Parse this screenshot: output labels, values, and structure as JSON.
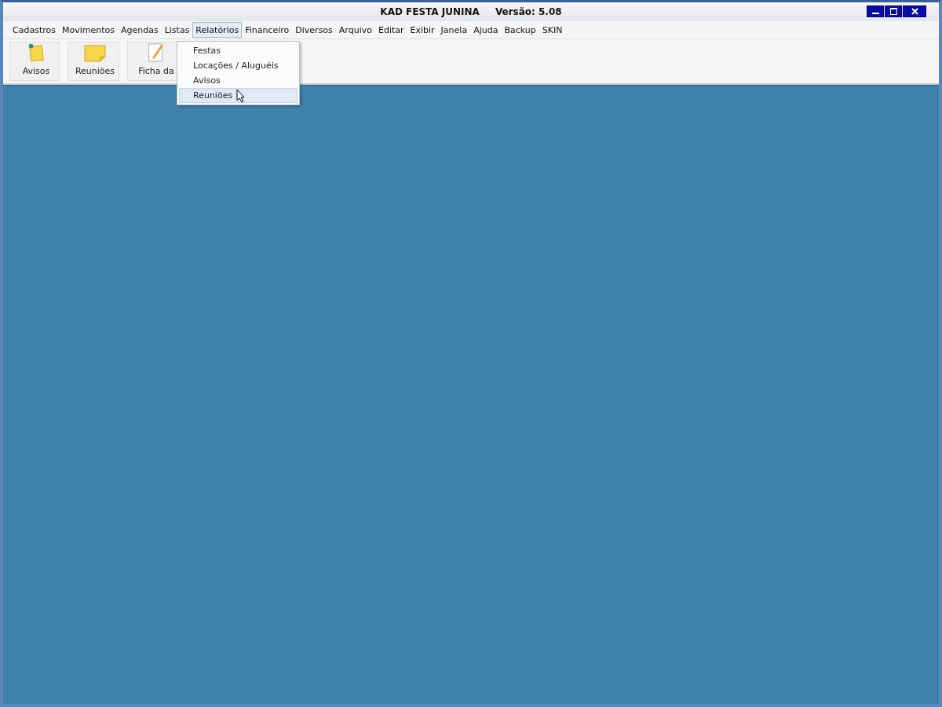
{
  "window": {
    "title": "KAD FESTA JUNINA",
    "version": "Versão: 5.08"
  },
  "menu": [
    {
      "label": "Cadastros",
      "selected": false
    },
    {
      "label": "Movimentos",
      "selected": false
    },
    {
      "label": "Agendas",
      "selected": false
    },
    {
      "label": "Listas",
      "selected": false
    },
    {
      "label": "Relatórios",
      "selected": true
    },
    {
      "label": "Financeiro",
      "selected": false
    },
    {
      "label": "Diversos",
      "selected": false
    },
    {
      "label": "Arquivo",
      "selected": false
    },
    {
      "label": "Editar",
      "selected": false
    },
    {
      "label": "Exibir",
      "selected": false
    },
    {
      "label": "Janela",
      "selected": false
    },
    {
      "label": "Ajuda",
      "selected": false
    },
    {
      "label": "Backup",
      "selected": false
    },
    {
      "label": "SKIN",
      "selected": false
    }
  ],
  "toolbar": [
    {
      "label": "Avisos",
      "kind": "pinned-note"
    },
    {
      "label": "Reuniões",
      "kind": "note"
    },
    {
      "label": "Ficha da",
      "kind": "pencil"
    }
  ],
  "dropdown": [
    {
      "label": "Festas",
      "selected": false
    },
    {
      "label": "Locações / Aluguéis",
      "selected": false
    },
    {
      "label": "Avisos",
      "selected": false
    },
    {
      "label": "Reuniões",
      "selected": true
    }
  ]
}
